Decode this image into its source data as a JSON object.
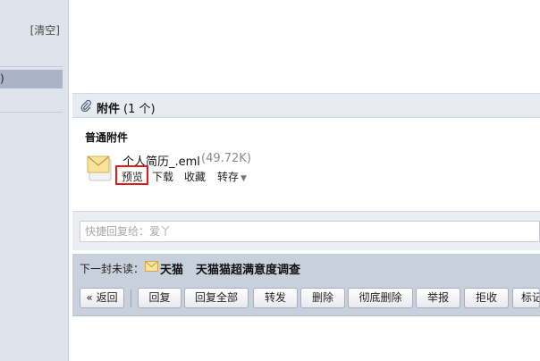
{
  "sidebar": {
    "clear_label": "[清空]",
    "selected_item_fragment": ")"
  },
  "attachments": {
    "title": "附件",
    "count_text": "(1 个)",
    "section_label": "普通附件",
    "file": {
      "name": "个人简历_.eml",
      "size": "(49.72K)",
      "icon": "envelope-icon"
    },
    "actions": {
      "preview": "预览",
      "download": "下载",
      "collect": "收藏",
      "save_to": "转存"
    }
  },
  "quick_reply": {
    "placeholder": "快捷回复给：爱丫"
  },
  "next_unread": {
    "label": "下一封未读：",
    "sender": "天猫",
    "subject": "天猫猫超满意度调查"
  },
  "toolbar": {
    "back": "« 返回",
    "reply": "回复",
    "reply_all": "回复全部",
    "forward": "转发",
    "delete": "删除",
    "delete_permanently": "彻底删除",
    "report": "举报",
    "reject": "拒收",
    "mark": "标记"
  },
  "colors": {
    "highlight_border": "#e11b1b",
    "toolbar_bg": "#c9d0dd",
    "sidebar_bg": "#dfe3ec"
  }
}
